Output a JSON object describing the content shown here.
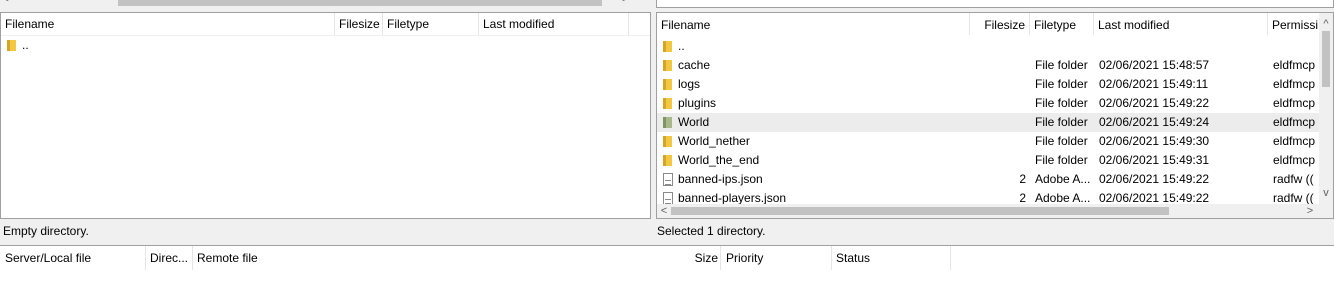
{
  "top_strip": {
    "left_arrow": "<",
    "right_arrow": ">"
  },
  "local_pane": {
    "columns": {
      "filename": "Filename",
      "filesize": "Filesize",
      "filetype": "Filetype",
      "last_modified": "Last modified"
    },
    "rows": [
      {
        "name": "..",
        "icon": "folder-icon"
      }
    ],
    "status": "Empty directory."
  },
  "remote_pane": {
    "columns": {
      "filename": "Filename",
      "filesize": "Filesize",
      "filetype": "Filetype",
      "last_modified": "Last modified",
      "permissions": "Permissi"
    },
    "rows": [
      {
        "name": "..",
        "size": "",
        "type": "",
        "modified": "",
        "perm": ""
      },
      {
        "name": "cache",
        "size": "",
        "type": "File folder",
        "modified": "02/06/2021 15:48:57",
        "perm": "eldfmcp"
      },
      {
        "name": "logs",
        "size": "",
        "type": "File folder",
        "modified": "02/06/2021 15:49:11",
        "perm": "eldfmcp"
      },
      {
        "name": "plugins",
        "size": "",
        "type": "File folder",
        "modified": "02/06/2021 15:49:22",
        "perm": "eldfmcp"
      },
      {
        "name": "World",
        "size": "",
        "type": "File folder",
        "modified": "02/06/2021 15:49:24",
        "perm": "eldfmcp"
      },
      {
        "name": "World_nether",
        "size": "",
        "type": "File folder",
        "modified": "02/06/2021 15:49:30",
        "perm": "eldfmcp"
      },
      {
        "name": "World_the_end",
        "size": "",
        "type": "File folder",
        "modified": "02/06/2021 15:49:31",
        "perm": "eldfmcp"
      },
      {
        "name": "banned-ips.json",
        "size": "2",
        "type": "Adobe A...",
        "modified": "02/06/2021 15:49:22",
        "perm": "radfw (("
      },
      {
        "name": "banned-players.json",
        "size": "2",
        "type": "Adobe A...",
        "modified": "02/06/2021 15:49:22",
        "perm": "radfw (("
      }
    ],
    "selected_row": "World",
    "status": "Selected 1 directory.",
    "scroll_left": "<",
    "scroll_right": ">",
    "scroll_up": "^",
    "scroll_down": "v"
  },
  "queue": {
    "columns": {
      "server_local_file": "Server/Local file",
      "direction": "Direc...",
      "remote_file": "Remote file",
      "size": "Size",
      "priority": "Priority",
      "status": "Status"
    }
  },
  "colors": {
    "selection": "#ececec",
    "folder": "#f2c744",
    "folder_special": "#a8b88a",
    "border": "#a0a0a0"
  }
}
